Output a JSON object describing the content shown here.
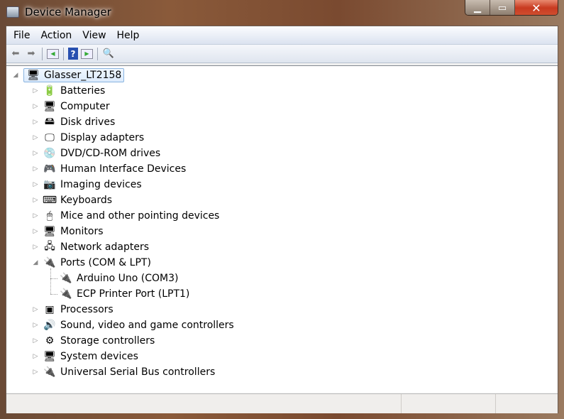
{
  "window": {
    "title": "Device Manager",
    "minimize_icon": "minimize-icon",
    "maximize_icon": "maximize-icon",
    "close_icon": "close-icon"
  },
  "menu": [
    "File",
    "Action",
    "View",
    "Help"
  ],
  "toolbar": [
    "back-arrow-icon",
    "forward-arrow-icon",
    "show-hide-console-tree-icon",
    "help-icon",
    "show-action-pane-icon",
    "scan-hardware-changes-icon"
  ],
  "tree": {
    "root": "Glasser_LT2158",
    "items": [
      {
        "label": "Batteries",
        "icon": "battery-icon",
        "glyph": "🔋"
      },
      {
        "label": "Computer",
        "icon": "computer-icon",
        "glyph": "🖥"
      },
      {
        "label": "Disk drives",
        "icon": "disk-drive-icon",
        "glyph": "🖴"
      },
      {
        "label": "Display adapters",
        "icon": "display-adapter-icon",
        "glyph": "🖵"
      },
      {
        "label": "DVD/CD-ROM drives",
        "icon": "dvd-drive-icon",
        "glyph": "💿"
      },
      {
        "label": "Human Interface Devices",
        "icon": "hid-icon",
        "glyph": "🎮"
      },
      {
        "label": "Imaging devices",
        "icon": "camera-icon",
        "glyph": "📷"
      },
      {
        "label": "Keyboards",
        "icon": "keyboard-icon",
        "glyph": "⌨"
      },
      {
        "label": "Mice and other pointing devices",
        "icon": "mouse-icon",
        "glyph": "🖱"
      },
      {
        "label": "Monitors",
        "icon": "monitor-icon",
        "glyph": "🖥"
      },
      {
        "label": "Network adapters",
        "icon": "network-adapter-icon",
        "glyph": "🖧"
      },
      {
        "label": "Ports (COM & LPT)",
        "icon": "port-icon",
        "glyph": "🔌",
        "expanded": true,
        "children": [
          {
            "label": "Arduino Uno (COM3)",
            "icon": "port-icon"
          },
          {
            "label": "ECP Printer Port (LPT1)",
            "icon": "port-icon"
          }
        ]
      },
      {
        "label": "Processors",
        "icon": "processor-icon",
        "glyph": "▣"
      },
      {
        "label": "Sound, video and game controllers",
        "icon": "speaker-icon",
        "glyph": "🔊"
      },
      {
        "label": "Storage controllers",
        "icon": "storage-controller-icon",
        "glyph": "⚙"
      },
      {
        "label": "System devices",
        "icon": "system-devices-icon",
        "glyph": "🖥"
      },
      {
        "label": "Universal Serial Bus controllers",
        "icon": "usb-icon",
        "glyph": "🔌"
      }
    ]
  }
}
